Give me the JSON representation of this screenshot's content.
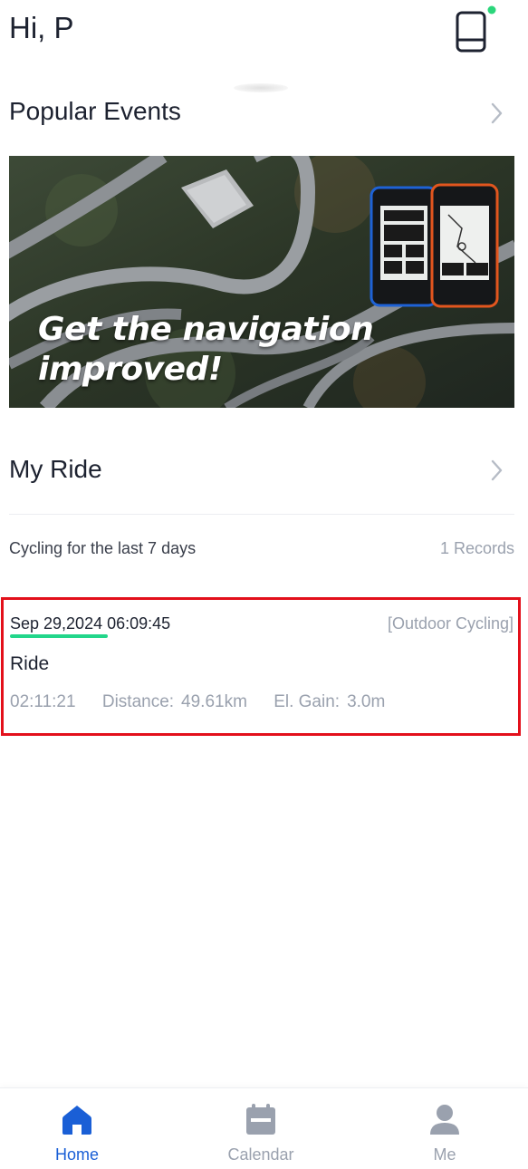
{
  "header": {
    "greeting": "Hi, P",
    "device_icon": "device-icon",
    "status_color": "#2bd67b"
  },
  "events": {
    "title": "Popular Events",
    "banner": {
      "text_line1": "Get the navigation",
      "text_line2": "improved!"
    }
  },
  "my_ride": {
    "title": "My Ride",
    "summary_label": "Cycling for the last 7 days",
    "summary_count": "1 Records",
    "rides": [
      {
        "date": "Sep 29,2024 06:09:45",
        "type": "[Outdoor Cycling]",
        "name": "Ride",
        "duration": "02:11:21",
        "distance_label": "Distance:",
        "distance_value": "49.61km",
        "elevation_label": "El. Gain:",
        "elevation_value": "3.0m"
      }
    ]
  },
  "tabbar": {
    "active_color": "#1a5fd6",
    "inactive_color": "#9aa1ae",
    "tabs": [
      {
        "label": "Home",
        "icon": "home-icon"
      },
      {
        "label": "Calendar",
        "icon": "calendar-icon"
      },
      {
        "label": "Me",
        "icon": "person-icon"
      }
    ]
  }
}
